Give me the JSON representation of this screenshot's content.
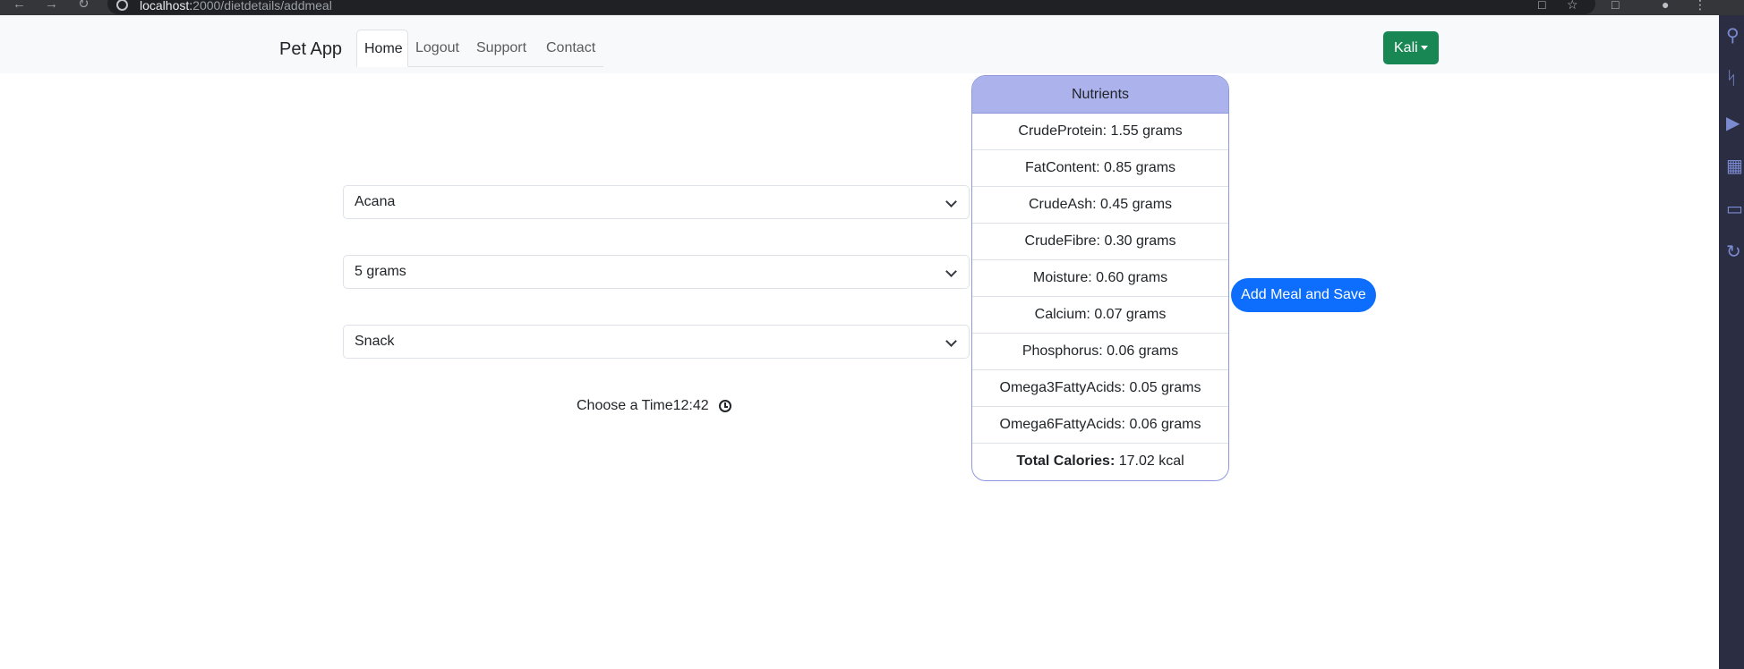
{
  "browser": {
    "url_host": "localhost:",
    "url_path": "2000/dietdetails/addmeal"
  },
  "navbar": {
    "brand": "Pet App",
    "links": [
      "Home",
      "Logout",
      "Support",
      "Contact"
    ],
    "active_link": "Home",
    "user_label": "Kali"
  },
  "form": {
    "food_select": "Acana",
    "amount_select": "5 grams",
    "meal_type_select": "Snack",
    "time_label": "Choose a Time",
    "time_value": "12:42"
  },
  "nutrients": {
    "header": "Nutrients",
    "rows": [
      "CrudeProtein: 1.55 grams",
      "FatContent: 0.85 grams",
      "CrudeAsh: 0.45 grams",
      "CrudeFibre: 0.30 grams",
      "Moisture: 0.60 grams",
      "Calcium: 0.07 grams",
      "Phosphorus: 0.06 grams",
      "Omega3FattyAcids: 0.05 grams",
      "Omega6FattyAcids: 0.06 grams"
    ],
    "total_label": "Total Calories:",
    "total_value": " 17.02 kcal"
  },
  "actions": {
    "add_meal_label": "Add Meal and Save"
  },
  "colors": {
    "brand_green": "#198754",
    "primary_blue": "#0d6efd",
    "card_header": "#acb2ec",
    "card_border": "#8e98de"
  }
}
